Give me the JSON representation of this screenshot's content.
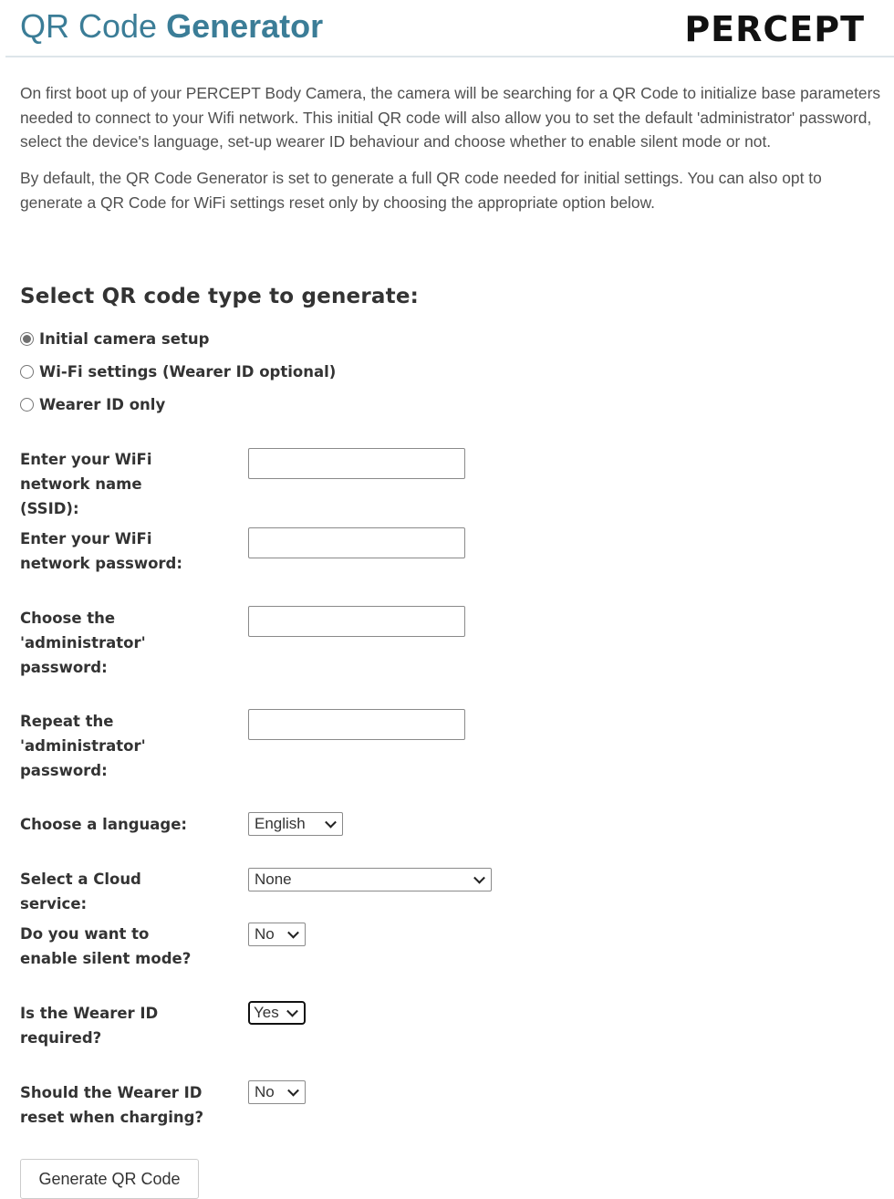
{
  "header": {
    "title_light": "QR Code",
    "title_bold": "Generator",
    "logo": "PERCEPT",
    "colors": {
      "title": "#3b7d97",
      "logo": "#111111"
    }
  },
  "intro": {
    "paragraph1": "On first boot up of your PERCEPT Body Camera, the camera will be searching for a QR Code to initialize base parameters needed to connect to your Wifi network. This initial QR code will also allow you to set the default 'administrator' password, select the device's language, set-up wearer ID behaviour and choose whether to enable silent mode or not.",
    "paragraph2": "By default, the QR Code Generator is set to generate a full QR code needed for initial settings. You can also opt to generate a QR Code for WiFi settings reset only by choosing the appropriate option below."
  },
  "qr_type": {
    "heading": "Select QR code type to generate:",
    "options": [
      {
        "label": "Initial camera setup",
        "checked": true
      },
      {
        "label": "Wi-Fi settings (Wearer ID optional)",
        "checked": false
      },
      {
        "label": "Wearer ID only",
        "checked": false
      }
    ]
  },
  "form": {
    "ssid": {
      "label": "Enter your WiFi network name (SSID):",
      "value": ""
    },
    "wifi_password": {
      "label": "Enter your WiFi network password:",
      "value": ""
    },
    "admin_password": {
      "label": "Choose the 'administrator' password:",
      "value": ""
    },
    "admin_password_repeat": {
      "label": "Repeat the 'administrator' password:",
      "value": ""
    },
    "language": {
      "label": "Choose a language:",
      "selected": "English"
    },
    "cloud": {
      "label": "Select a Cloud service:",
      "selected": "None"
    },
    "silent_mode": {
      "label": "Do you want to enable silent mode?",
      "selected": "No"
    },
    "wearer_required": {
      "label": "Is the Wearer ID required?",
      "selected": "Yes"
    },
    "wearer_reset": {
      "label": "Should the Wearer ID reset when charging?",
      "selected": "No"
    }
  },
  "submit": {
    "label": "Generate QR Code"
  }
}
